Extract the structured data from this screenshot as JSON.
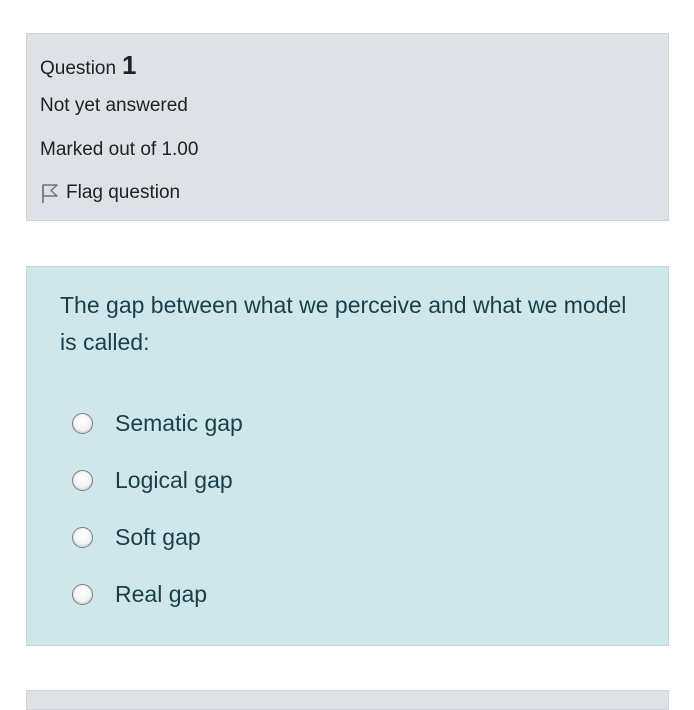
{
  "question_info": {
    "label": "Question",
    "number": "1",
    "state": "Not yet answered",
    "grade": "Marked out of 1.00",
    "flag_label": "Flag question"
  },
  "question": {
    "text": "The gap between what we perceive and what we model is called:",
    "answers": [
      {
        "label": "Sematic gap",
        "selected": false
      },
      {
        "label": "Logical gap",
        "selected": false
      },
      {
        "label": "Soft gap",
        "selected": false
      },
      {
        "label": "Real gap",
        "selected": false
      }
    ]
  },
  "colors": {
    "info_background": "#dee2e6",
    "content_background": "#cfe6ea",
    "question_text": "#1a3f4b"
  }
}
